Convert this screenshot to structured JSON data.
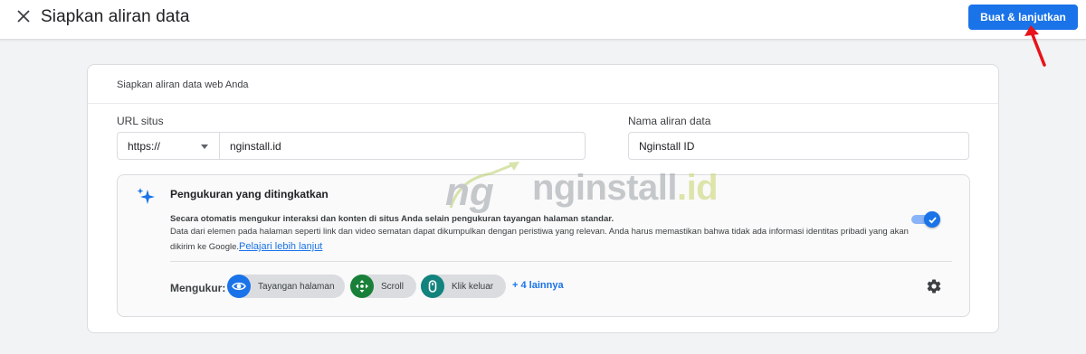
{
  "header": {
    "title": "Siapkan aliran data",
    "primary_button": "Buat & lanjutkan"
  },
  "card": {
    "heading": "Siapkan aliran data web Anda",
    "url_label": "URL situs",
    "protocol_selected": "https://",
    "url_value": "nginstall.id",
    "stream_name_label": "Nama aliran data",
    "stream_name_value": "Nginstall ID"
  },
  "enhanced_measurement": {
    "title": "Pengukuran yang ditingkatkan",
    "description_bold": "Secara otomatis mengukur interaksi dan konten di situs Anda selain pengukuran tayangan halaman standar.",
    "description": "Data dari elemen pada halaman seperti link dan video sematan dapat dikumpulkan dengan peristiwa yang relevan. Anda harus memastikan bahwa tidak ada informasi identitas pribadi yang akan dikirim ke Google.",
    "learn_more": "Pelajari lebih lanjut",
    "toggle_on": true,
    "measuring_label": "Mengukur:",
    "chips": [
      {
        "label": "Tayangan halaman",
        "icon": "eye-icon"
      },
      {
        "label": "Scroll",
        "icon": "scroll-crosshair-icon"
      },
      {
        "label": "Klik keluar",
        "icon": "mouse-icon"
      }
    ],
    "more": "+ 4 lainnya"
  },
  "watermark": {
    "logo_text": "ng",
    "text_main": "nginstall",
    "text_accent": ".id"
  },
  "colors": {
    "primary": "#1a73e8",
    "annotation_arrow": "#e8131b"
  }
}
